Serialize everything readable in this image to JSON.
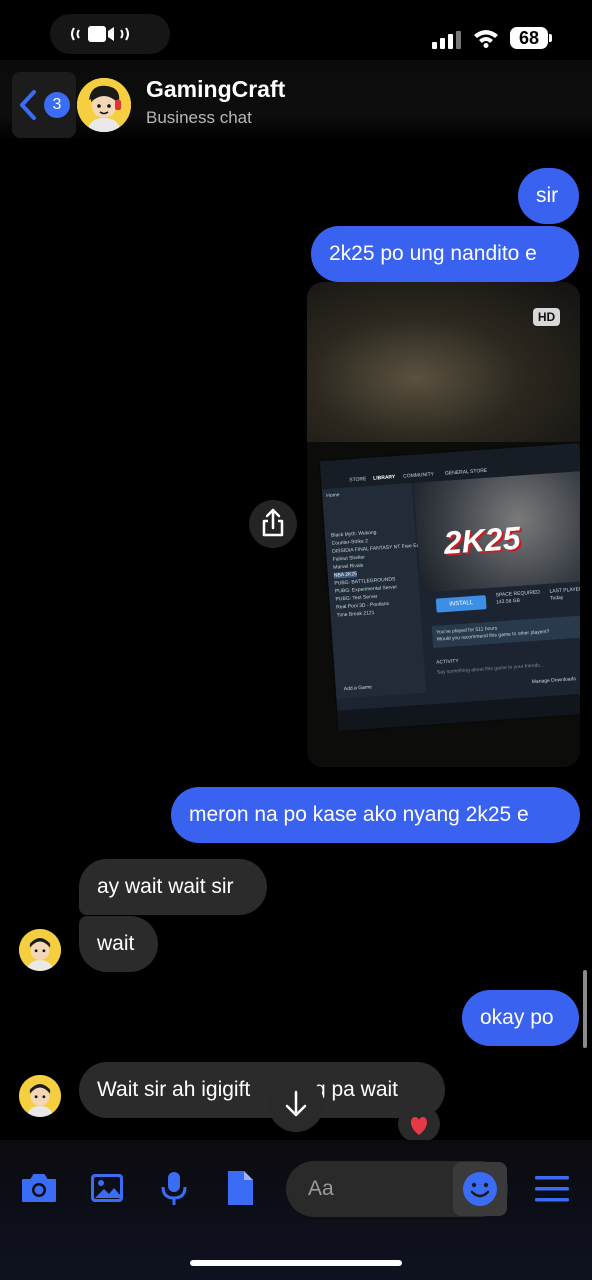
{
  "status_bar": {
    "battery": "68"
  },
  "header": {
    "unread_count": "3",
    "title": "GamingCraft",
    "subtitle": "Business chat"
  },
  "messages": [
    {
      "id": "sir",
      "direction": "outgoing",
      "text": "sir"
    },
    {
      "id": "2k25",
      "direction": "outgoing",
      "text": "2k25 po ung nandito e"
    },
    {
      "id": "media",
      "direction": "outgoing",
      "type": "video",
      "badge": "HD",
      "content": {
        "steam_title": "2K25",
        "install_label": "INSTALL",
        "tabs": [
          "STORE",
          "LIBRARY",
          "COMMUNITY",
          "GENERAL STORE"
        ],
        "games": [
          "Black Myth: Wukong",
          "Counter-Strike 2",
          "DISSIDIA FINAL FANTASY NT Free Edit",
          "Fallout Shelter",
          "Marvel Rivals",
          "NBA 2K25",
          "PUBG: BATTLEGROUNDS",
          "PUBG: Experimental Server",
          "PUBG: Test Server",
          "Real Pool 3D - Poolians",
          "Time Break 2121"
        ],
        "sidebar_header": "Home",
        "space_label": "SPACE REQUIRED",
        "space_value": "143.56 GB",
        "last_played_label": "LAST PLAYED",
        "last_played_value": "Today",
        "review_prompt": "You've played for 511 hours",
        "review_question": "Would you recommend this game to other players?",
        "activity_label": "ACTIVITY",
        "activity_placeholder": "Say something about this game to your friends...",
        "add_game": "Add a Game",
        "manage_downloads": "Manage Downloads"
      }
    },
    {
      "id": "meron",
      "direction": "outgoing",
      "text": "meron na po kase ako nyang 2k25 e"
    },
    {
      "id": "ay",
      "direction": "incoming",
      "text": "ay wait wait sir"
    },
    {
      "id": "wait",
      "direction": "incoming",
      "text": "wait"
    },
    {
      "id": "okay",
      "direction": "outgoing",
      "text": "okay po"
    },
    {
      "id": "igigift",
      "direction": "incoming",
      "text": "Wait sir ah igigift",
      "hidden_tail": "ng pa wait",
      "reaction": "heart"
    }
  ],
  "composer": {
    "placeholder": "Aa"
  },
  "colors": {
    "accent": "#3a62f0",
    "incoming_bubble": "#2b2b2b",
    "background": "#000000"
  },
  "icons": [
    "camera-icon",
    "image-icon",
    "microphone-icon",
    "file-icon",
    "emoji-icon",
    "menu-icon",
    "share-icon",
    "chevron-down-icon"
  ]
}
